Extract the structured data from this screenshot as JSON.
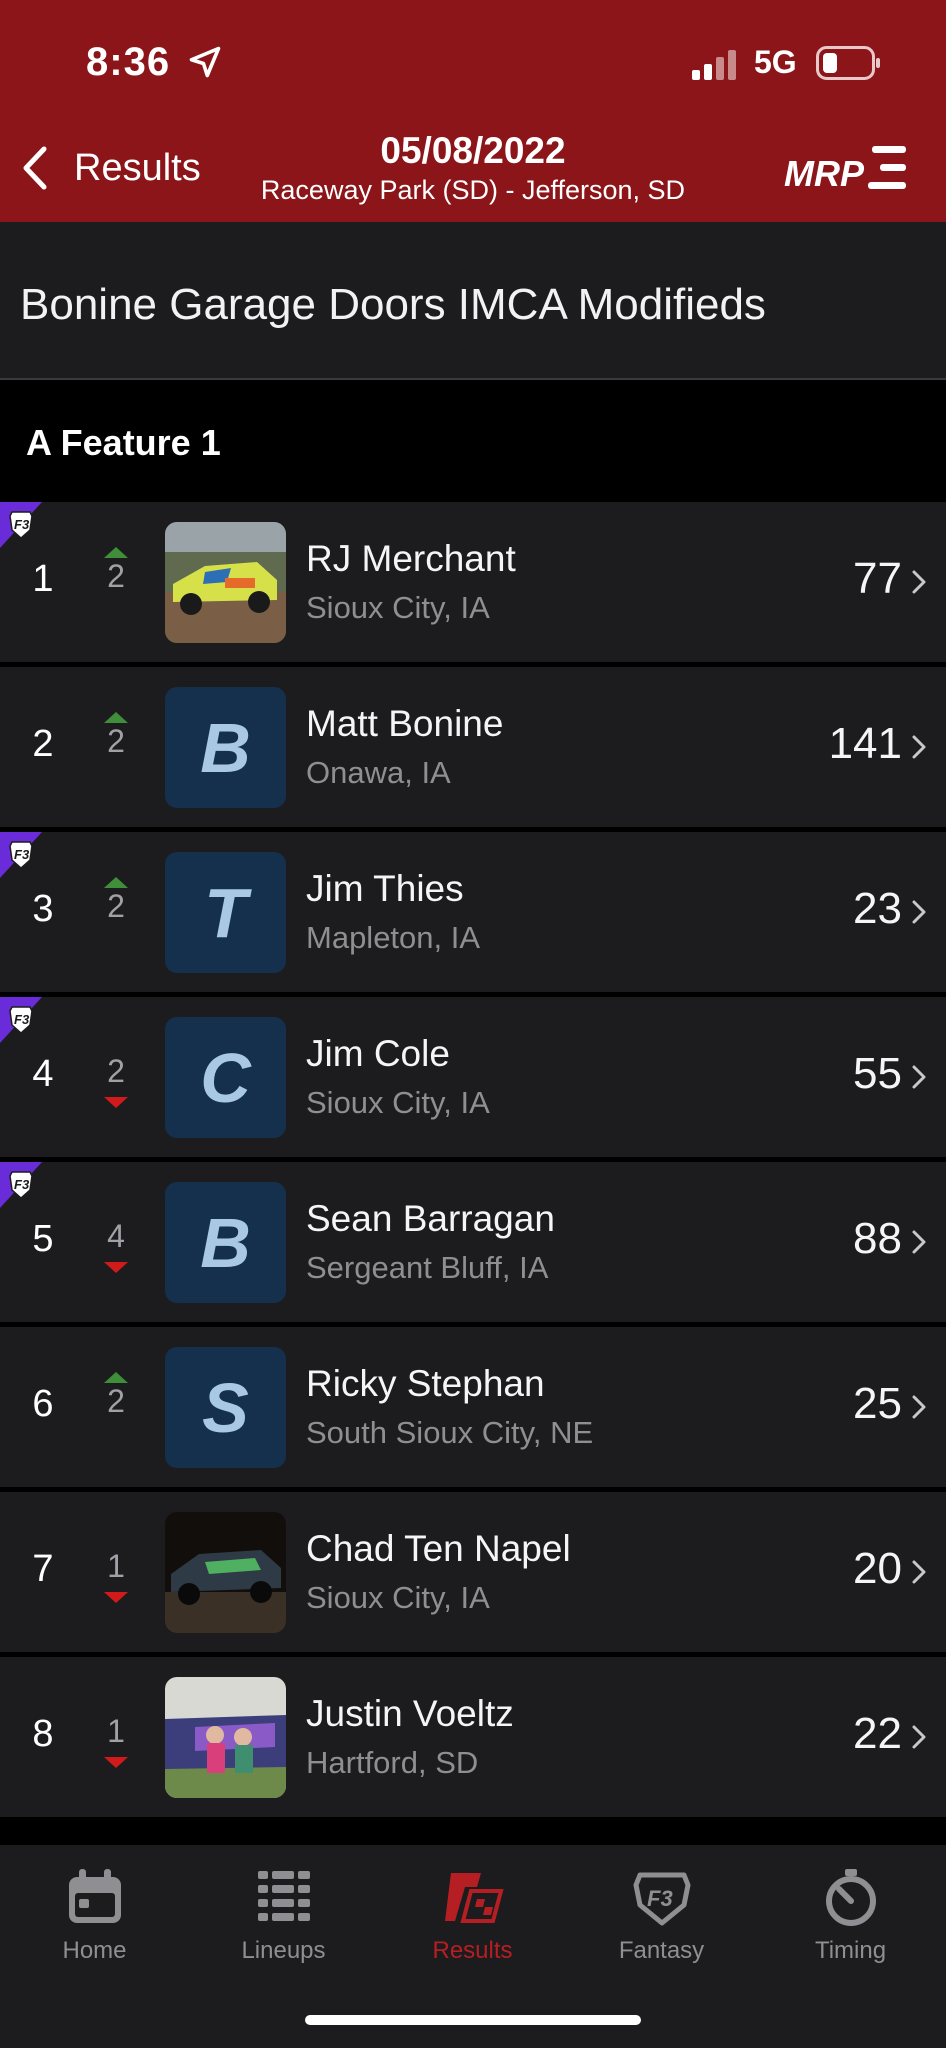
{
  "status_bar": {
    "time": "8:36",
    "network": "5G"
  },
  "nav": {
    "back_label": "Results",
    "date": "05/08/2022",
    "track": "Raceway Park (SD) - Jefferson, SD",
    "logo_text": "MRP"
  },
  "class_title": "Bonine Garage Doors IMCA Modifieds",
  "feature_title": "A Feature 1",
  "colors": {
    "header_red": "#8b1519",
    "up_arrow": "#3f8f3a",
    "down_arrow": "#d11b1b",
    "active_tab": "#b51f23",
    "avatar_bg": "#15304d"
  },
  "results": [
    {
      "position": "1",
      "change": "2",
      "direction": "up",
      "f3": true,
      "avatar": "photo-yellow-car",
      "avatar_letter": "",
      "name": "RJ Merchant",
      "hometown": "Sioux City, IA",
      "car_number": "77"
    },
    {
      "position": "2",
      "change": "2",
      "direction": "up",
      "f3": false,
      "avatar": "letter",
      "avatar_letter": "B",
      "name": "Matt Bonine",
      "hometown": "Onawa, IA",
      "car_number": "141"
    },
    {
      "position": "3",
      "change": "2",
      "direction": "up",
      "f3": true,
      "avatar": "letter",
      "avatar_letter": "T",
      "name": "Jim Thies",
      "hometown": "Mapleton, IA",
      "car_number": "23"
    },
    {
      "position": "4",
      "change": "2",
      "direction": "down",
      "f3": true,
      "avatar": "letter",
      "avatar_letter": "C",
      "name": "Jim Cole",
      "hometown": "Sioux City, IA",
      "car_number": "55"
    },
    {
      "position": "5",
      "change": "4",
      "direction": "down",
      "f3": true,
      "avatar": "letter",
      "avatar_letter": "B",
      "name": "Sean Barragan",
      "hometown": "Sergeant Bluff, IA",
      "car_number": "88"
    },
    {
      "position": "6",
      "change": "2",
      "direction": "up",
      "f3": false,
      "avatar": "letter",
      "avatar_letter": "S",
      "name": "Ricky Stephan",
      "hometown": "South Sioux City, NE",
      "car_number": "25"
    },
    {
      "position": "7",
      "change": "1",
      "direction": "down",
      "f3": false,
      "avatar": "photo-night-car",
      "avatar_letter": "",
      "name": "Chad Ten Napel",
      "hometown": "Sioux City, IA",
      "car_number": "20"
    },
    {
      "position": "8",
      "change": "1",
      "direction": "down",
      "f3": false,
      "avatar": "photo-family",
      "avatar_letter": "",
      "name": "Justin Voeltz",
      "hometown": "Hartford, SD",
      "car_number": "22"
    }
  ],
  "tabs": [
    {
      "label": "Home",
      "icon": "calendar-icon",
      "active": false
    },
    {
      "label": "Lineups",
      "icon": "lineups-icon",
      "active": false
    },
    {
      "label": "Results",
      "icon": "results-flag-icon",
      "active": true
    },
    {
      "label": "Fantasy",
      "icon": "fantasy-shield-icon",
      "active": false
    },
    {
      "label": "Timing",
      "icon": "stopwatch-icon",
      "active": false
    }
  ]
}
